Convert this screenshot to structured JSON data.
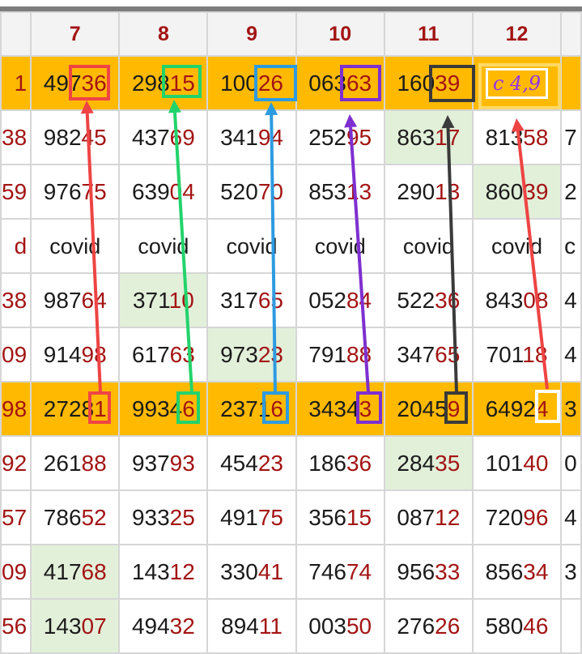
{
  "columns": {
    "left_partial": "",
    "headers": [
      "7",
      "8",
      "9",
      "10",
      "11",
      "12"
    ],
    "right_partial": ""
  },
  "rows": [
    {
      "left": "1",
      "highlight": true,
      "cells": [
        [
          "497",
          "36"
        ],
        [
          "298",
          "15"
        ],
        [
          "100",
          "26"
        ],
        [
          "063",
          "63"
        ],
        [
          "160",
          "39"
        ],
        [
          "c 4,9",
          ""
        ]
      ],
      "right": ""
    },
    {
      "left": "38",
      "highlight": false,
      "cells": [
        [
          "982",
          "45"
        ],
        [
          "437",
          "69"
        ],
        [
          "341",
          "94"
        ],
        [
          "252",
          "95"
        ],
        [
          "863",
          "17"
        ],
        [
          "813",
          "58"
        ]
      ],
      "right": "7"
    },
    {
      "left": "59",
      "highlight": false,
      "cells": [
        [
          "976",
          "75"
        ],
        [
          "639",
          "04"
        ],
        [
          "520",
          "70"
        ],
        [
          "853",
          "13"
        ],
        [
          "290",
          "13"
        ],
        [
          "860",
          "39"
        ]
      ],
      "right": "2"
    },
    {
      "left": "d",
      "highlight": false,
      "cells": [
        [
          "covid",
          ""
        ],
        [
          "covid",
          ""
        ],
        [
          "covid",
          ""
        ],
        [
          "covid",
          ""
        ],
        [
          "covid",
          ""
        ],
        [
          "covid",
          ""
        ]
      ],
      "right": "c"
    },
    {
      "left": "38",
      "highlight": false,
      "cells": [
        [
          "987",
          "64"
        ],
        [
          "371",
          "10"
        ],
        [
          "317",
          "65"
        ],
        [
          "052",
          "84"
        ],
        [
          "522",
          "36"
        ],
        [
          "843",
          "08"
        ]
      ],
      "right": "4"
    },
    {
      "left": "09",
      "highlight": false,
      "cells": [
        [
          "914",
          "98"
        ],
        [
          "617",
          "63"
        ],
        [
          "973",
          "23"
        ],
        [
          "791",
          "88"
        ],
        [
          "347",
          "65"
        ],
        [
          "701",
          "18"
        ]
      ],
      "right": "4"
    },
    {
      "left": "98",
      "highlight": true,
      "cells": [
        [
          "2728",
          "1"
        ],
        [
          "9934",
          "6"
        ],
        [
          "2371",
          "6"
        ],
        [
          "3434",
          "3"
        ],
        [
          "2045",
          "9"
        ],
        [
          "6492",
          "4"
        ]
      ],
      "right": "3"
    },
    {
      "left": "92",
      "highlight": false,
      "cells": [
        [
          "261",
          "88"
        ],
        [
          "937",
          "93"
        ],
        [
          "454",
          "23"
        ],
        [
          "186",
          "36"
        ],
        [
          "284",
          "35"
        ],
        [
          "101",
          "40"
        ]
      ],
      "right": "0"
    },
    {
      "left": "57",
      "highlight": false,
      "cells": [
        [
          "786",
          "52"
        ],
        [
          "933",
          "25"
        ],
        [
          "491",
          "75"
        ],
        [
          "356",
          "15"
        ],
        [
          "087",
          "12"
        ],
        [
          "720",
          "96"
        ]
      ],
      "right": "4"
    },
    {
      "left": "09",
      "highlight": false,
      "cells": [
        [
          "417",
          "68"
        ],
        [
          "143",
          "12"
        ],
        [
          "330",
          "41"
        ],
        [
          "746",
          "74"
        ],
        [
          "956",
          "33"
        ],
        [
          "856",
          "34"
        ]
      ],
      "right": "3"
    },
    {
      "left": "56",
      "highlight": false,
      "cells": [
        [
          "143",
          "07"
        ],
        [
          "494",
          "32"
        ],
        [
          "894",
          "11"
        ],
        [
          "003",
          "50"
        ],
        [
          "276",
          "26"
        ],
        [
          "580",
          "46"
        ]
      ],
      "right": ""
    }
  ],
  "green_cells": [
    "r1c4",
    "r2c5",
    "r3c6",
    "r4c1",
    "r5c2",
    "r7c4",
    "r8c6",
    "r9c0",
    "r10c0"
  ],
  "peach_cells": [
    "r10c6"
  ],
  "annotation_colors": {
    "col7": "#ef4444",
    "col8": "#22d36b",
    "col9": "#2d9be0",
    "col10": "#7e2fd0",
    "col11": "#3a3a3a",
    "col12": "#ef4444"
  }
}
